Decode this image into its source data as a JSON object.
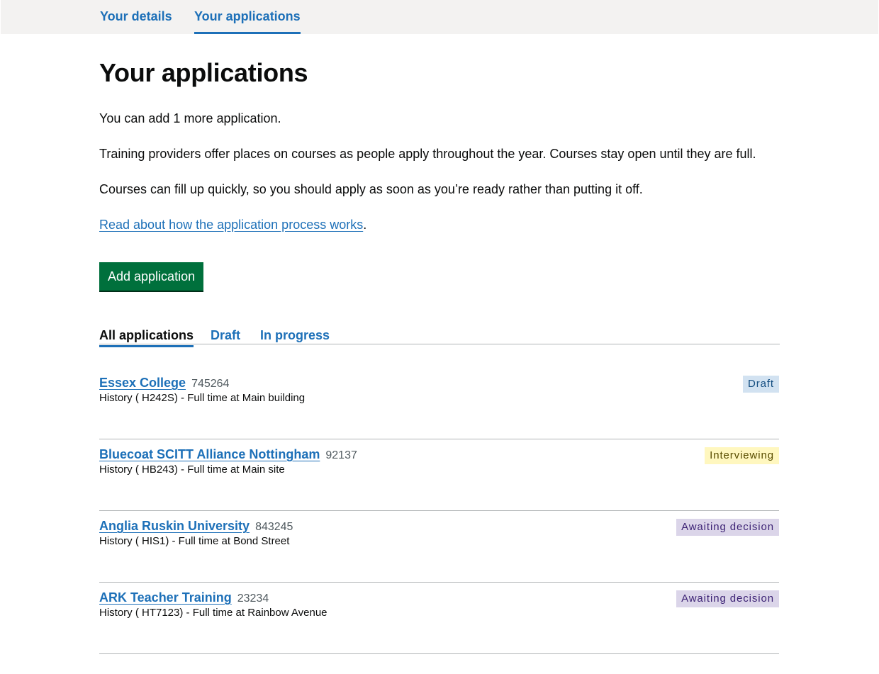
{
  "nav": {
    "details_label": "Your details",
    "applications_label": "Your applications"
  },
  "page": {
    "title": "Your applications",
    "remaining_text": "You can add 1 more application.",
    "intro_text": "Training providers offer places on courses as people apply throughout the year. Courses stay open until they are full.",
    "urgency_text": "Courses can fill up quickly, so you should apply as soon as you’re ready rather than putting it off.",
    "process_link": "Read about how the application process works",
    "process_link_suffix": ".",
    "add_button": "Add application"
  },
  "tabs": {
    "all": "All applications",
    "draft": "Draft",
    "in_progress": "In progress"
  },
  "applications": [
    {
      "provider": "Essex College",
      "id": "745264",
      "course": "History ( H242S) - Full time at Main building",
      "status": "Draft",
      "status_color": "#d2e2f1"
    },
    {
      "provider": "Bluecoat SCITT Alliance Nottingham",
      "id": "92137",
      "course": "History ( HB243) - Full time at Main site",
      "status": "Interviewing",
      "status_color": "#fff7bf"
    },
    {
      "provider": "Anglia Ruskin University",
      "id": "843245",
      "course": "History ( HIS1) - Full time at Bond Street",
      "status": "Awaiting decision",
      "status_color": "#dbd5e9"
    },
    {
      "provider": "ARK Teacher Training",
      "id": "23234",
      "course": "History ( HT7123) - Full time at Rainbow Avenue",
      "status": "Awaiting decision",
      "status_color": "#dbd5e9"
    }
  ],
  "colors": {
    "link": "#1d70b8",
    "button": "#00703c",
    "text": "#0b0c0c",
    "nav_bg": "#f3f2f1"
  }
}
